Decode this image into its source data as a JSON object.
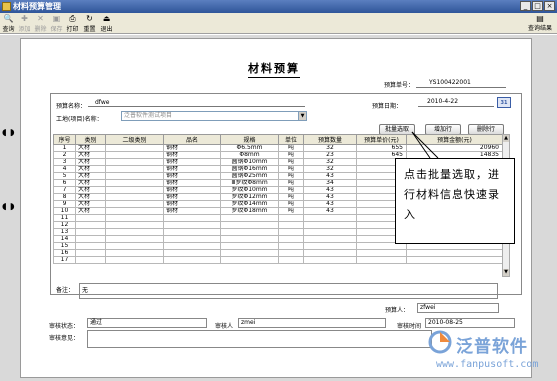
{
  "window": {
    "title": "材料预算管理"
  },
  "toolbar": {
    "items": [
      {
        "label": "查询",
        "icon": "search-icon",
        "enabled": true
      },
      {
        "label": "添加",
        "icon": "add-icon",
        "enabled": false
      },
      {
        "label": "删除",
        "icon": "delete-icon",
        "enabled": false
      },
      {
        "label": "保存",
        "icon": "save-icon",
        "enabled": false
      },
      {
        "label": "打印",
        "icon": "print-icon",
        "enabled": true
      },
      {
        "label": "重置",
        "icon": "reset-icon",
        "enabled": true
      },
      {
        "label": "退出",
        "icon": "exit-icon",
        "enabled": true
      }
    ],
    "right_label": "查询结果"
  },
  "document": {
    "title": "材料预算",
    "budget_no_label": "预算单号：",
    "budget_no": "YS100422001",
    "budget_name_label": "预算名称：",
    "budget_name": "dfwe",
    "budget_date_label": "预算日期：",
    "budget_date": "2010-4-22",
    "project_label": "工地(项目)名称：",
    "project_placeholder": "泛普软件测试项目",
    "buttons": {
      "batch": "批量选取",
      "add_row": "增加行",
      "delete_row": "删除行"
    }
  },
  "grid": {
    "headers": [
      "序号",
      "类别",
      "二级类别",
      "品名",
      "规格",
      "单位",
      "预算数量",
      "预算单价(元)",
      "预算金额(元)"
    ],
    "rows": [
      [
        "1",
        "大材",
        "",
        "钢材",
        "Φ6.5mm",
        "吨",
        "32",
        "655",
        "20960"
      ],
      [
        "2",
        "大材",
        "",
        "钢材",
        "Φ8mm",
        "吨",
        "23",
        "645",
        "14835"
      ],
      [
        "3",
        "大材",
        "",
        "钢材",
        "圆钢Φ10mm",
        "吨",
        "32",
        "",
        ""
      ],
      [
        "4",
        "大材",
        "",
        "钢材",
        "圆钢Φ16mm",
        "吨",
        "32",
        "",
        ""
      ],
      [
        "5",
        "大材",
        "",
        "钢材",
        "圆钢Φ25mm",
        "吨",
        "43",
        "",
        ""
      ],
      [
        "6",
        "大材",
        "",
        "钢材",
        "Ⅲ罗纹Φ8mm",
        "吨",
        "34",
        "",
        ""
      ],
      [
        "7",
        "大材",
        "",
        "钢材",
        "罗纹Φ10mm",
        "吨",
        "43",
        "",
        ""
      ],
      [
        "8",
        "大材",
        "",
        "钢材",
        "罗纹Φ12mm",
        "吨",
        "43",
        "",
        ""
      ],
      [
        "9",
        "大材",
        "",
        "钢材",
        "罗纹Φ14mm",
        "吨",
        "43",
        "",
        ""
      ],
      [
        "10",
        "大材",
        "",
        "钢材",
        "罗纹Φ18mm",
        "吨",
        "43",
        "",
        ""
      ],
      [
        "11",
        "",
        "",
        "",
        "",
        "",
        "",
        "",
        ""
      ],
      [
        "12",
        "",
        "",
        "",
        "",
        "",
        "",
        "",
        ""
      ],
      [
        "13",
        "",
        "",
        "",
        "",
        "",
        "",
        "",
        ""
      ],
      [
        "14",
        "",
        "",
        "",
        "",
        "",
        "",
        "",
        ""
      ],
      [
        "15",
        "",
        "",
        "",
        "",
        "",
        "",
        "",
        ""
      ],
      [
        "16",
        "",
        "",
        "",
        "",
        "",
        "",
        "",
        ""
      ],
      [
        "17",
        "",
        "",
        "",
        "",
        "",
        "",
        "",
        ""
      ]
    ]
  },
  "remark": {
    "label": "备注：",
    "value": "无"
  },
  "preparer": {
    "label": "预算人：",
    "value": "zfwei"
  },
  "approval": {
    "status_label": "审核状态：",
    "status_value": "通过",
    "approver_label": "审核人",
    "approver_value": "zmei",
    "time_label": "审核时间",
    "time_value": "2010-08-25",
    "opinion_label": "审核意见："
  },
  "callout": {
    "text": "点击批量选取，进行材料信息快速录入"
  },
  "watermark": {
    "brand": "泛普软件",
    "url": "www.fanpusoft.com"
  },
  "colors": {
    "titlebar": "#2f5599",
    "toolbar": "#ece9d8",
    "watermark": "#7aa3d8"
  }
}
